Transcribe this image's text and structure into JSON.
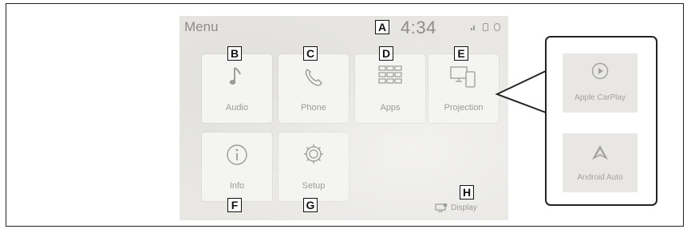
{
  "screen": {
    "menu_title": "Menu",
    "clock": "4:34",
    "status_icons": [
      "signal-icon",
      "phone-status-icon",
      "bluetooth-icon"
    ]
  },
  "tiles": [
    {
      "label": "Audio",
      "icon": "music-note-icon",
      "marker": "B"
    },
    {
      "label": "Phone",
      "icon": "phone-handset-icon",
      "marker": "C"
    },
    {
      "label": "Apps",
      "icon": "apps-grid-icon",
      "marker": "D"
    },
    {
      "label": "Projection",
      "icon": "projection-icon",
      "marker": "E"
    },
    {
      "label": "Info",
      "icon": "info-icon",
      "marker": "F"
    },
    {
      "label": "Setup",
      "icon": "gear-icon",
      "marker": "G"
    }
  ],
  "clock_marker": "A",
  "display": {
    "label": "Display",
    "marker": "H"
  },
  "projection_popup": {
    "items": [
      {
        "label": "Apple CarPlay",
        "icon": "play-circle-icon"
      },
      {
        "label": "Android Auto",
        "icon": "android-auto-icon"
      }
    ]
  },
  "colors": {
    "screen_bg": "#e8e7e4",
    "tile_bg": "#f4f4f2",
    "label_text": "#9b9b99",
    "marker_border": "#111111"
  }
}
